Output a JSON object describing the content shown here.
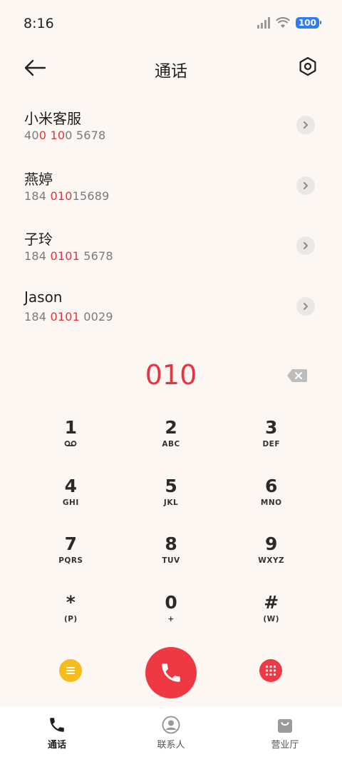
{
  "status_bar": {
    "time": "8:16",
    "battery": "100"
  },
  "header": {
    "title": "通话"
  },
  "contacts": [
    {
      "name": "小米客服",
      "number_parts": [
        "40",
        "0",
        " ",
        "10",
        "0 5678"
      ]
    },
    {
      "name": "燕婷",
      "number_parts": [
        "184 ",
        "010",
        "15689"
      ]
    },
    {
      "name": "子玲",
      "number_parts": [
        "184 ",
        "0101",
        " 5678"
      ]
    },
    {
      "name": "Jason",
      "number_parts": [
        "184 ",
        "0101",
        " 0029"
      ]
    }
  ],
  "dialer": {
    "number": "010"
  },
  "keypad": [
    {
      "digit": "1",
      "letters": ""
    },
    {
      "digit": "2",
      "letters": "ABC"
    },
    {
      "digit": "3",
      "letters": "DEF"
    },
    {
      "digit": "4",
      "letters": "GHI"
    },
    {
      "digit": "5",
      "letters": "JKL"
    },
    {
      "digit": "6",
      "letters": "MNO"
    },
    {
      "digit": "7",
      "letters": "PQRS"
    },
    {
      "digit": "8",
      "letters": "TUV"
    },
    {
      "digit": "9",
      "letters": "WXYZ"
    },
    {
      "digit": "*",
      "letters": "(P)"
    },
    {
      "digit": "0",
      "letters": "+"
    },
    {
      "digit": "#",
      "letters": "(W)"
    }
  ],
  "bottom_nav": [
    {
      "label": "通话",
      "icon": "phone-icon",
      "active": true
    },
    {
      "label": "联系人",
      "icon": "contact-icon",
      "active": false
    },
    {
      "label": "营业厅",
      "icon": "shop-bag-icon",
      "active": false
    }
  ],
  "colors": {
    "accent_red": "#e8323f",
    "menu_yellow": "#f5bc1c",
    "battery_blue": "#2f7bf5"
  }
}
